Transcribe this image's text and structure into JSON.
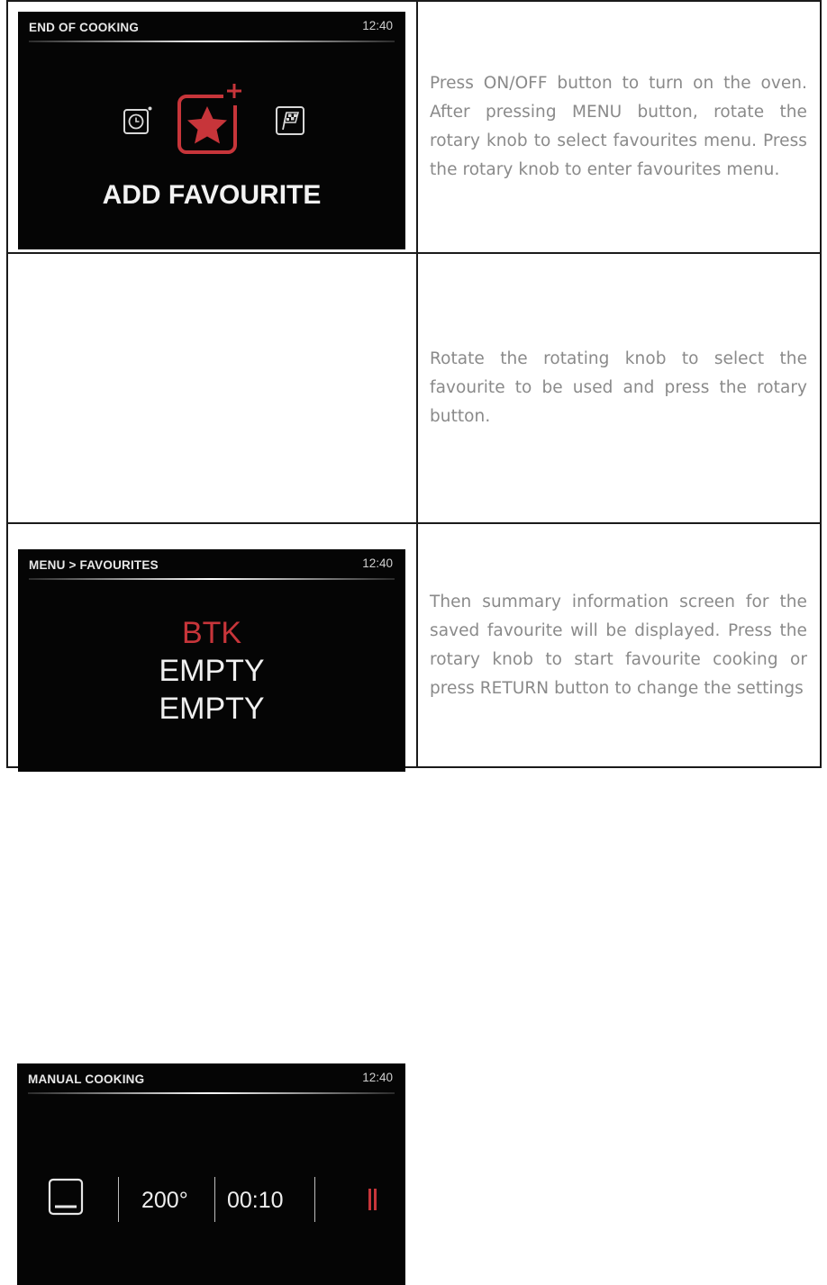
{
  "rows": [
    {
      "screen": {
        "title": "END OF COOKING",
        "time": "12:40",
        "label": "ADD FAVOURITE",
        "icons": [
          "timer-icon",
          "add-favourite-star-icon",
          "finish-flag-icon"
        ]
      },
      "description": "Press ON/OFF button to turn on the oven. After pressing MENU button, rotate the rotary knob to select favourites menu. Press the rotary knob to enter favourites menu."
    },
    {
      "screen": {
        "title": "MENU > FAVOURITES",
        "time": "12:40",
        "items": [
          "BTK",
          "EMPTY",
          "EMPTY"
        ],
        "selected_index": 0
      },
      "description": "Rotate the rotating knob to select the favourite to be used and press the rotary button."
    },
    {
      "screen": {
        "title": "MANUAL COOKING",
        "time": "12:40",
        "temperature": "200°",
        "duration": "00:10",
        "icons": [
          "oven-mode-icon",
          "pause-icon"
        ]
      },
      "description": "Then summary information screen for the saved favourite will be displayed. Press the rotary knob to start favourite cooking or press RETURN button to change the settings"
    }
  ],
  "colors": {
    "screen_bg": "#050505",
    "accent_red": "#c7353a",
    "text_gray": "#8a8a8a"
  }
}
